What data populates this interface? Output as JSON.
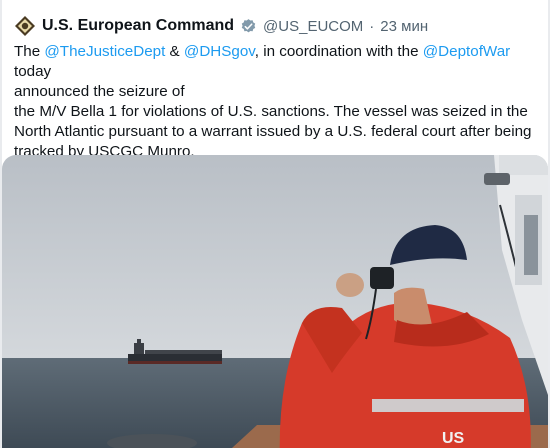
{
  "tweet": {
    "author": {
      "name": "U.S. European Command",
      "handle": "@US_EUCOM",
      "separator": "·",
      "time": "23 мин",
      "logo_icon": "eucom-seal-icon",
      "verified_icon": "verified-badge-icon"
    },
    "text": {
      "l1_prefix": "The ",
      "l1_mention1": "@TheJusticeDept",
      "l1_mid1": " & ",
      "l1_mention2": "@DHSgov",
      "l1_mid2": ", in coordination with the ",
      "l1_mention3": "@DeptofWar",
      "l1_suffix": " today",
      "l2": "announced the seizure of",
      "l3": "the M/V Bella 1 for violations of U.S. sanctions. The vessel was seized in the",
      "l4": "North Atlantic pursuant to a warrant issued by a U.S. federal court after being",
      "l5": "tracked by USCGC Munro."
    },
    "media": {
      "jacket_letters": "US"
    }
  },
  "colors": {
    "text": "#0f1419",
    "secondary": "#536471",
    "mention": "#1d9bf0",
    "jacket": "#d63a2a"
  }
}
